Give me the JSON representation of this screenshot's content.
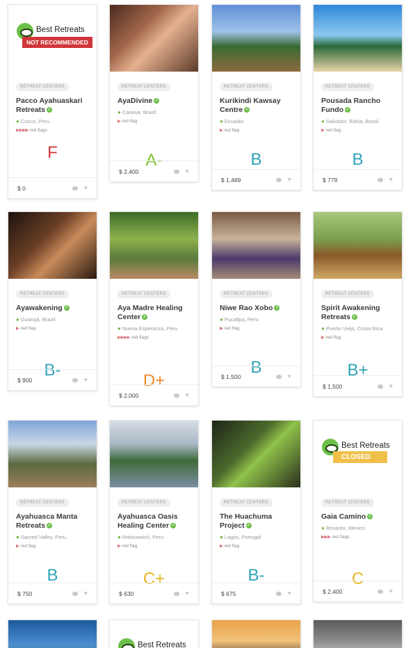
{
  "colors": {
    "red": "#d0363a",
    "green": "#7bbf2a",
    "teal": "#2fa3b8",
    "orange": "#ef8a2a",
    "yellow": "#e9b623"
  },
  "logo": {
    "text": "Best Retreats"
  },
  "cards": [
    {
      "tag": "RETREAT CENTERS",
      "name": "Pacco Ayahuaskari Retreats",
      "location": "Cusco, Peru",
      "flags_icons": "▶▶▶▶",
      "flags_text": "red flags",
      "grade": "F",
      "grade_color": "red",
      "price": "$ 0",
      "image": "logo",
      "banner": "NOT RECOMMENDED"
    },
    {
      "tag": "RETREAT CENTERS",
      "name": "AyaDivine",
      "location": "Caraiva, Brazil",
      "flags_icons": "▶",
      "flags_text": "red flag",
      "grade": "A-",
      "grade_color": "green",
      "price": "$ 2,400",
      "image": "photo"
    },
    {
      "tag": "RETREAT CENTERS",
      "name": "Kurikindi Kawsay Centre",
      "location": "Ecuador",
      "flags_icons": "▶",
      "flags_text": "red flag",
      "grade": "B",
      "grade_color": "teal",
      "price": "$ 1,489",
      "image": "photo"
    },
    {
      "tag": "RETREAT CENTERS",
      "name": "Pousada Rancho Fundo",
      "location": "Salvador, Bahia, Brazil",
      "flags_icons": "▶",
      "flags_text": "red flag",
      "grade": "B",
      "grade_color": "teal",
      "price": "$ 779",
      "image": "photo"
    },
    {
      "tag": "RETREAT CENTERS",
      "name": "Ayawakening",
      "location": "Guarujá, Brazil",
      "flags_icons": "▶",
      "flags_text": "red flag",
      "grade": "B-",
      "grade_color": "teal",
      "price": "$ 900",
      "image": "photo"
    },
    {
      "tag": "RETREAT CENTERS",
      "name": "Aya Madre Healing Center",
      "location": "Nueva Esperanza, Peru",
      "flags_icons": "▶▶▶▶",
      "flags_text": "red flags",
      "grade": "D+",
      "grade_color": "orange",
      "price": "$ 2,000",
      "image": "photo"
    },
    {
      "tag": "RETREAT CENTERS",
      "name": "Niwe Rao Xobo",
      "location": "Pucallpa, Peru",
      "flags_icons": "▶",
      "flags_text": "red flag",
      "grade": "B",
      "grade_color": "teal",
      "price": "$ 1,500",
      "image": "photo"
    },
    {
      "tag": "RETREAT CENTERS",
      "name": "Spirit Awakening Retreats",
      "location": "Puerto Viejo, Costa Rica",
      "flags_icons": "▶",
      "flags_text": "red flag",
      "grade": "B+",
      "grade_color": "teal",
      "price": "$ 1,500",
      "image": "photo"
    },
    {
      "tag": "RETREAT CENTERS",
      "name": "Ayahuasca Manta Retreats",
      "location": "Sacred Valley, Peru",
      "flags_icons": "▶",
      "flags_text": "red flag",
      "grade": "B",
      "grade_color": "teal",
      "price": "$ 750",
      "image": "photo"
    },
    {
      "tag": "RETREAT CENTERS",
      "name": "Ayahuasca Oasis Healing Center",
      "location": "Malocawich, Peru",
      "flags_icons": "▶",
      "flags_text": "red flag",
      "grade": "C+",
      "grade_color": "yellow",
      "price": "$ 630",
      "image": "photo"
    },
    {
      "tag": "RETREAT CENTERS",
      "name": "The Huachuma Project",
      "location": "Lagos, Portugal",
      "flags_icons": "▶",
      "flags_text": "red flag",
      "grade": "B-",
      "grade_color": "teal",
      "price": "$ 675",
      "image": "photo"
    },
    {
      "tag": "RETREAT CENTERS",
      "name": "Gaia Camino",
      "location": "Rosarito, Mexico",
      "flags_icons": "▶▶▶",
      "flags_text": "red flags",
      "grade": "C",
      "grade_color": "yellow",
      "price": "$ 2,400",
      "image": "logo",
      "banner": "CLOSED"
    },
    {
      "image": "photo"
    },
    {
      "image": "logo"
    },
    {
      "image": "photo"
    },
    {
      "image": "photo"
    }
  ]
}
